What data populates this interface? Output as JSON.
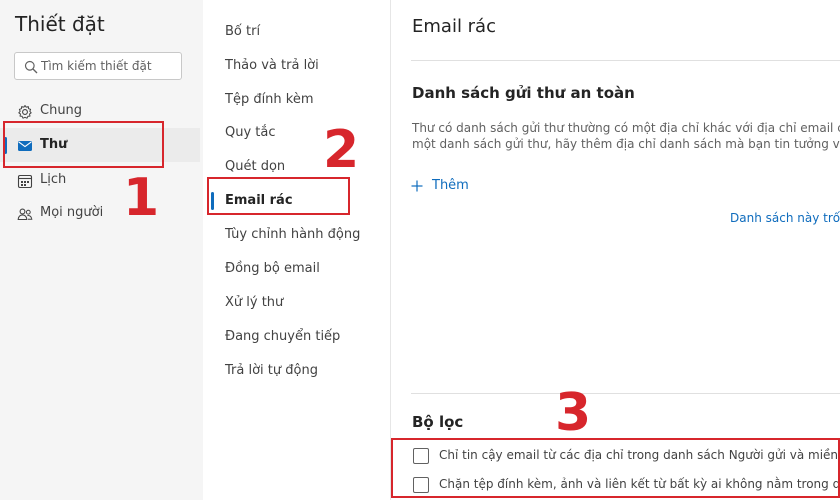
{
  "settings_title": "Thiết đặt",
  "search": {
    "placeholder": "Tìm kiếm thiết đặt"
  },
  "nav": {
    "items": [
      {
        "label": "Chung",
        "icon": "gear-icon"
      },
      {
        "label": "Thư",
        "icon": "mail-icon",
        "selected": true
      },
      {
        "label": "Lịch",
        "icon": "calendar-icon"
      },
      {
        "label": "Mọi người",
        "icon": "people-icon"
      }
    ]
  },
  "subnav": {
    "items": [
      {
        "label": "Bố trí"
      },
      {
        "label": "Thảo và trả lời"
      },
      {
        "label": "Tệp đính kèm"
      },
      {
        "label": "Quy tắc"
      },
      {
        "label": "Quét dọn"
      },
      {
        "label": "Email rác",
        "selected": true
      },
      {
        "label": "Tùy chỉnh hành động"
      },
      {
        "label": "Đồng bộ email"
      },
      {
        "label": "Xử lý thư"
      },
      {
        "label": "Đang chuyển tiếp"
      },
      {
        "label": "Trả lời tự động"
      }
    ]
  },
  "content": {
    "title": "Email rác",
    "safe_senders": {
      "heading": "Danh sách gửi thư an toàn",
      "desc_line1": "Thư có danh sách gửi thư thường có một địa chỉ khác với địa chỉ email củ",
      "desc_line2": "một danh sách gửi thư, hãy thêm địa chỉ danh sách mà bạn tin tưởng vào",
      "add_label": "Thêm",
      "empty_text": "Danh sách này trống"
    },
    "filters": {
      "heading": "Bộ lọc",
      "options": [
        {
          "label": "Chỉ tin cậy email từ các địa chỉ trong danh sách Người gửi và miền an toàn",
          "checked": false
        },
        {
          "label": "Chặn tệp đính kèm, ảnh và liên kết từ bất kỳ ai không nằm trong danh sách",
          "checked": false
        }
      ]
    }
  },
  "annotations": {
    "n1": "1",
    "n2": "2",
    "n3": "3"
  },
  "colors": {
    "accent": "#0f6cbd",
    "annotation": "#d7262c",
    "sidebar_bg": "#f5f5f5"
  }
}
